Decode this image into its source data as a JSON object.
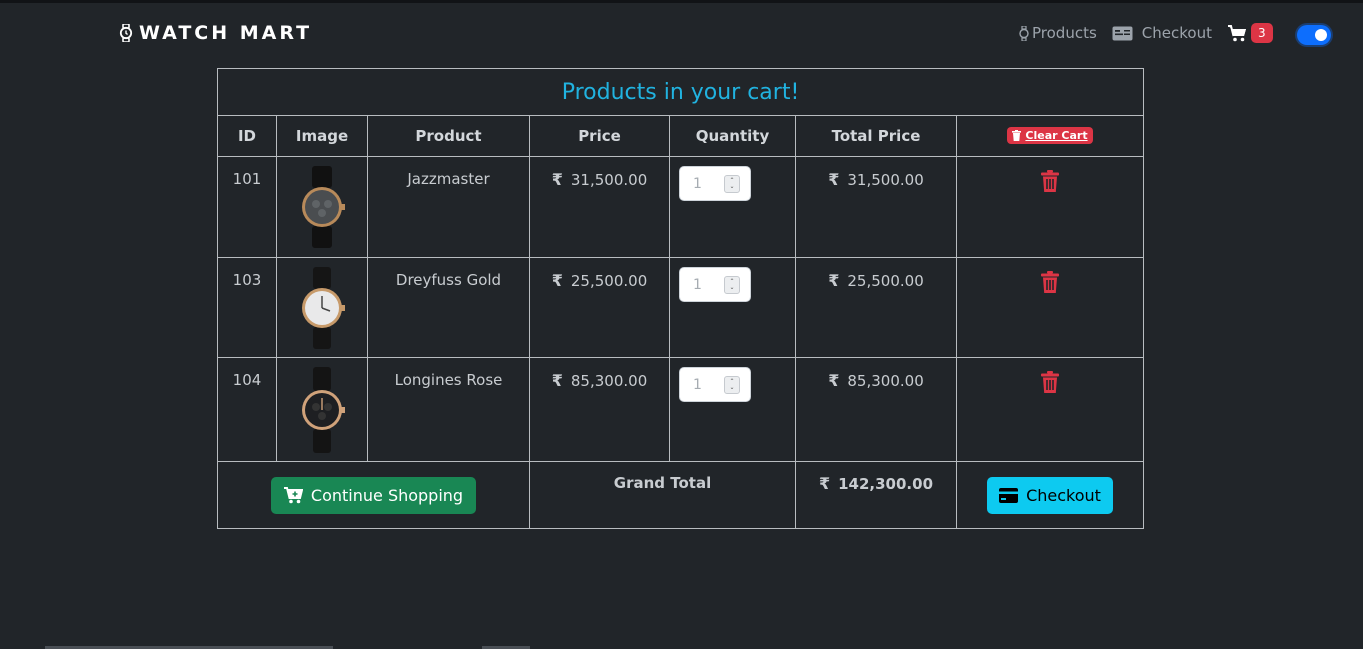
{
  "brand": {
    "name": "WATCH MART",
    "icon": "watch-icon"
  },
  "nav": {
    "products_label": "Products",
    "checkout_label": "Checkout",
    "cart_count": "3"
  },
  "table": {
    "title": "Products in your cart!",
    "headers": [
      "ID",
      "Image",
      "Product",
      "Price",
      "Quantity",
      "Total Price"
    ],
    "clear_cart_label": "Clear Cart",
    "rows": [
      {
        "id": "101",
        "product": "Jazzmaster",
        "price": "31,500.00",
        "quantity": "1",
        "total": "31,500.00"
      },
      {
        "id": "103",
        "product": "Dreyfuss Gold",
        "price": "25,500.00",
        "quantity": "1",
        "total": "25,500.00"
      },
      {
        "id": "104",
        "product": "Longines Rose",
        "price": "85,300.00",
        "quantity": "1",
        "total": "85,300.00"
      }
    ],
    "currency_symbol": "₹",
    "continue_shopping_label": "Continue Shopping",
    "grand_total_label": "Grand Total",
    "grand_total_value": "142,300.00",
    "checkout_button_label": "Checkout"
  },
  "colors": {
    "background": "#212529",
    "title": "#21b3e0",
    "danger": "#dc3545",
    "success": "#198754",
    "info": "#0dcaf0",
    "primary": "#0d6efd"
  }
}
